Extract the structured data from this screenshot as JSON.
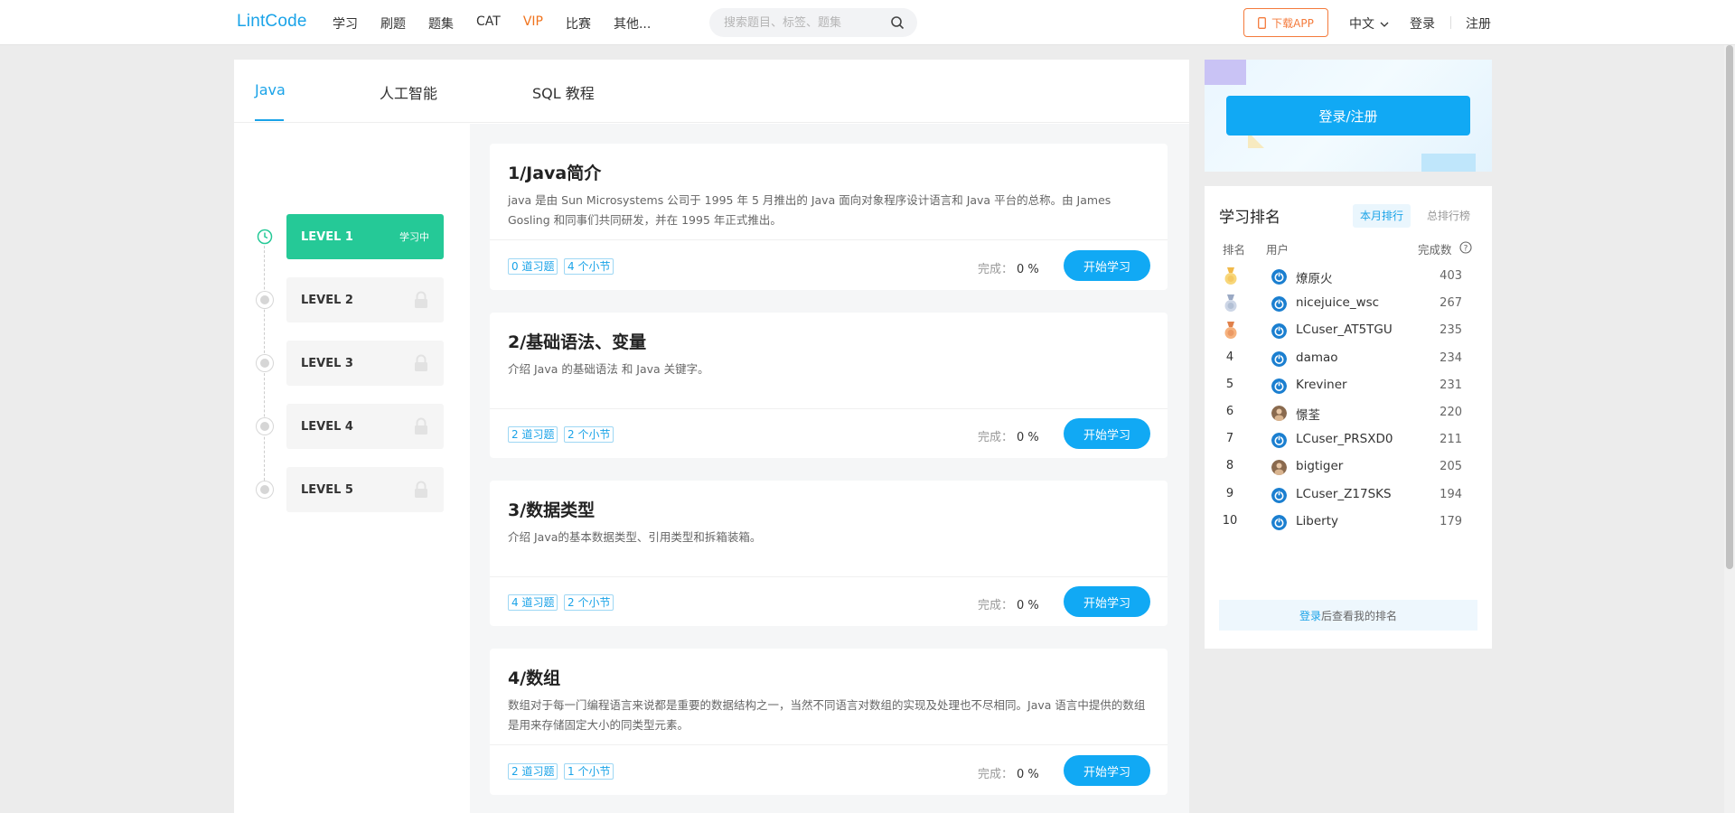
{
  "header": {
    "logo": "LintCode",
    "nav": [
      "学习",
      "刷题",
      "题集",
      "CAT",
      "VIP",
      "比赛",
      "其他..."
    ],
    "search_placeholder": "搜索题目、标签、题集",
    "download_label": "下载APP",
    "lang_label": "中文",
    "login_label": "登录",
    "register_label": "注册"
  },
  "tabs": [
    "Java",
    "人工智能",
    "SQL 教程"
  ],
  "levels": [
    {
      "label": "LEVEL 1",
      "status": "学习中",
      "locked": false
    },
    {
      "label": "LEVEL 2",
      "status": "",
      "locked": true
    },
    {
      "label": "LEVEL 3",
      "status": "",
      "locked": true
    },
    {
      "label": "LEVEL 4",
      "status": "",
      "locked": true
    },
    {
      "label": "LEVEL 5",
      "status": "",
      "locked": true
    }
  ],
  "lessons": [
    {
      "title": "1/Java简介",
      "desc": "java 是由 Sun Microsystems 公司于 1995 年 5 月推出的 Java 面向对象程序设计语言和 Java 平台的总称。由 James Gosling 和同事们共同研发，并在 1995 年正式推出。",
      "questions": "0 道习题",
      "sections": "4 个小节",
      "done_label": "完成：",
      "done_value": "0 %",
      "button": "开始学习"
    },
    {
      "title": "2/基础语法、变量",
      "desc": "介绍 Java 的基础语法 和 Java 关键字。",
      "questions": "2 道习题",
      "sections": "2 个小节",
      "done_label": "完成：",
      "done_value": "0 %",
      "button": "开始学习"
    },
    {
      "title": "3/数据类型",
      "desc": "介绍 Java的基本数据类型、引用类型和拆箱装箱。",
      "questions": "4 道习题",
      "sections": "2 个小节",
      "done_label": "完成：",
      "done_value": "0 %",
      "button": "开始学习"
    },
    {
      "title": "4/数组",
      "desc": "数组对于每一门编程语言来说都是重要的数据结构之一，当然不同语言对数组的实现及处理也不尽相同。Java 语言中提供的数组是用来存储固定大小的同类型元素。",
      "questions": "2 道习题",
      "sections": "1 个小节",
      "done_label": "完成：",
      "done_value": "0 %",
      "button": "开始学习"
    }
  ],
  "promo": {
    "login_button": "登录/注册"
  },
  "ranking": {
    "title": "学习排名",
    "tab_month": "本月排行",
    "tab_total": "总排行榜",
    "col_rank": "排名",
    "col_user": "用户",
    "col_done": "完成数",
    "rows": [
      {
        "rank": "",
        "medal": "gold",
        "name": "燎原火",
        "score": "403",
        "avatar": "blue-power-icon"
      },
      {
        "rank": "",
        "medal": "silver",
        "name": "nicejuice_wsc",
        "score": "267",
        "avatar": "blue-power-icon"
      },
      {
        "rank": "",
        "medal": "bronze",
        "name": "LCuser_AT5TGU",
        "score": "235",
        "avatar": "blue-power-icon"
      },
      {
        "rank": "4",
        "medal": "",
        "name": "damao",
        "score": "234",
        "avatar": "blue-power-icon"
      },
      {
        "rank": "5",
        "medal": "",
        "name": "Kreviner",
        "score": "231",
        "avatar": "blue-power-icon"
      },
      {
        "rank": "6",
        "medal": "",
        "name": "憬荃",
        "score": "220",
        "avatar": "photo-avatar"
      },
      {
        "rank": "7",
        "medal": "",
        "name": "LCuser_PRSXD0",
        "score": "211",
        "avatar": "blue-power-icon"
      },
      {
        "rank": "8",
        "medal": "",
        "name": "bigtiger",
        "score": "205",
        "avatar": "photo-avatar"
      },
      {
        "rank": "9",
        "medal": "",
        "name": "LCuser_Z17SKS",
        "score": "194",
        "avatar": "blue-power-icon"
      },
      {
        "rank": "10",
        "medal": "",
        "name": "Liberty",
        "score": "179",
        "avatar": "blue-power-icon"
      }
    ],
    "footer_link": "登录",
    "footer_text": "后查看我的排名"
  },
  "colors": {
    "accent": "#1aa3e8",
    "active_level": "#25c997",
    "vip": "#f0731d",
    "button": "#11a9f4"
  }
}
